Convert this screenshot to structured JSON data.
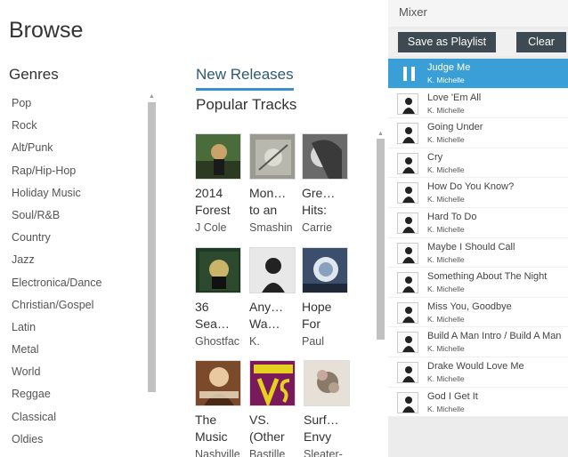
{
  "browse": {
    "title": "Browse",
    "genres_title": "Genres",
    "genres": [
      "Pop",
      "Rock",
      "Alt/Punk",
      "Rap/Hip-Hop",
      "Holiday Music",
      "Soul/R&B",
      "Country",
      "Jazz",
      "Electronica/Dance",
      "Christian/Gospel",
      "Latin",
      "Metal",
      "World",
      "Reggae",
      "Classical",
      "Oldies"
    ]
  },
  "nav": {
    "new_releases": "New Releases",
    "popular_tracks": "Popular Tracks"
  },
  "tracks": [
    {
      "title": "2014 Forest",
      "artist": "J Cole",
      "art_color": "#4a6b3a",
      "art_accent": "#c9a36a"
    },
    {
      "title": "Mon… to an",
      "artist": "Smashin",
      "art_color": "#9a9a90",
      "art_accent": "#dcdcd0"
    },
    {
      "title": "Gre… Hits:",
      "artist": "Carrie",
      "art_color": "#6a6a6a",
      "art_accent": "#d8d8d8"
    },
    {
      "title": "36 Sea…",
      "artist": "Ghostfac",
      "art_color": "#1f3a22",
      "art_accent": "#c9b46a"
    },
    {
      "title": "Any… Wa…",
      "artist": "K.",
      "art_color": "#e8e8e8",
      "art_accent": "#222222"
    },
    {
      "title": "Hope For",
      "artist": "Paul",
      "art_color": "#3b4e6b",
      "art_accent": "#e0e6ee"
    },
    {
      "title": "The Music",
      "artist": "Nashville",
      "art_color": "#7a4a2a",
      "art_accent": "#e8c9a0"
    },
    {
      "title": "VS. (Other",
      "artist": "Bastille",
      "art_color": "#7a1a5a",
      "art_accent": "#e6d020"
    },
    {
      "title": "Surf… Envy",
      "artist": "Sleater-",
      "art_color": "#e6e0d6",
      "art_accent": "#8a7a6a"
    }
  ],
  "mixer": {
    "title": "Mixer",
    "save_label": "Save as Playlist",
    "clear_label": "Clear",
    "active_color": "#3a9fd6",
    "queue": [
      {
        "title": "Judge Me",
        "artist": "K. Michelle",
        "playing": true
      },
      {
        "title": "Love 'Em All",
        "artist": "K. Michelle"
      },
      {
        "title": "Going Under",
        "artist": "K. Michelle"
      },
      {
        "title": "Cry",
        "artist": "K. Michelle"
      },
      {
        "title": "How Do You Know?",
        "artist": "K. Michelle"
      },
      {
        "title": "Hard To Do",
        "artist": "K. Michelle"
      },
      {
        "title": "Maybe I Should Call",
        "artist": "K. Michelle"
      },
      {
        "title": "Something About The Night",
        "artist": "K. Michelle"
      },
      {
        "title": "Miss You, Goodbye",
        "artist": "K. Michelle"
      },
      {
        "title": "Build A Man Intro / Build A Man",
        "artist": "K. Michelle"
      },
      {
        "title": "Drake Would Love Me",
        "artist": "K. Michelle"
      },
      {
        "title": "God I Get It",
        "artist": "K. Michelle"
      }
    ]
  }
}
